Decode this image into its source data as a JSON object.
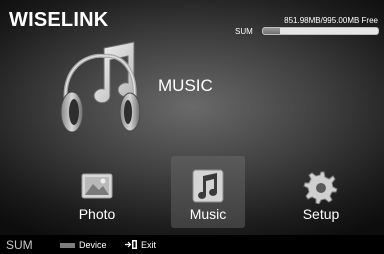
{
  "header": {
    "title": "WISELINK",
    "storage_free_text": "851.98MB/995.00MB Free",
    "storage_label": "SUM",
    "storage_used_fraction": 0.144
  },
  "category": {
    "title": "MUSIC",
    "hero_icon": "headphones-music-note-icon"
  },
  "menu": {
    "items": [
      {
        "label": "Photo",
        "icon": "photo-icon",
        "selected": false
      },
      {
        "label": "Music",
        "icon": "music-note-icon",
        "selected": true
      },
      {
        "label": "Setup",
        "icon": "gear-icon",
        "selected": false
      }
    ]
  },
  "footer": {
    "sum_label": "SUM",
    "device_label": "Device",
    "exit_label": "Exit",
    "device_chip_color": "#7d7d7d"
  }
}
